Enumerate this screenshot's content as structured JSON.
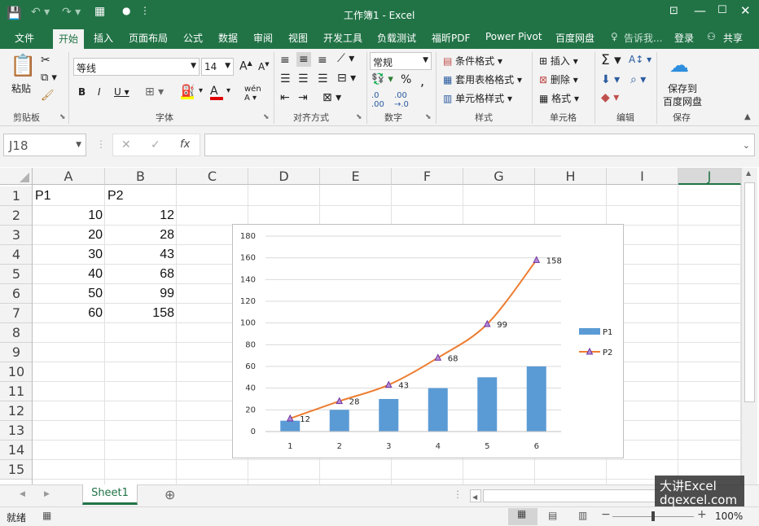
{
  "title_bar": {
    "title": "工作簿1 - Excel"
  },
  "menu": {
    "items": [
      "文件",
      "开始",
      "插入",
      "页面布局",
      "公式",
      "数据",
      "审阅",
      "视图",
      "开发工具",
      "负载测试",
      "福昕PDF",
      "Power Pivot",
      "百度网盘"
    ],
    "tell_me": "告诉我...",
    "login": "登录",
    "share": "共享"
  },
  "ribbon": {
    "paste": "粘贴",
    "clipboard": "剪贴板",
    "font_name": "等线",
    "font_size": "14",
    "font_group": "字体",
    "align_group": "对齐方式",
    "number_format": "常规",
    "number_group": "数字",
    "cond_format": "条件格式",
    "table_format": "套用表格格式",
    "cell_style": "单元格样式",
    "style_group": "样式",
    "insert": "插入",
    "delete": "删除",
    "format": "格式",
    "cells_group": "单元格",
    "edit_group": "编辑",
    "save_to": "保存到",
    "baidu_disk": "百度网盘",
    "save_group": "保存"
  },
  "formula_bar": {
    "name_box": "J18",
    "fx": "fx",
    "formula": ""
  },
  "columns": [
    "A",
    "B",
    "C",
    "D",
    "E",
    "F",
    "G",
    "H",
    "I",
    "J"
  ],
  "rows": [
    "1",
    "2",
    "3",
    "4",
    "5",
    "6",
    "7",
    "8",
    "9",
    "10",
    "11",
    "12",
    "13",
    "14",
    "15"
  ],
  "cells": {
    "A1": "P1",
    "B1": "P2",
    "A2": "10",
    "B2": "12",
    "A3": "20",
    "B3": "28",
    "A4": "30",
    "B4": "43",
    "A5": "40",
    "B5": "68",
    "A6": "50",
    "B6": "99",
    "A7": "60",
    "B7": "158"
  },
  "chart_data": {
    "type": "bar",
    "categories": [
      "1",
      "2",
      "3",
      "4",
      "5",
      "6"
    ],
    "series": [
      {
        "name": "P1",
        "type": "bar",
        "values": [
          10,
          20,
          30,
          40,
          50,
          60
        ],
        "color": "#5b9bd5"
      },
      {
        "name": "P2",
        "type": "line",
        "values": [
          12,
          28,
          43,
          68,
          99,
          158
        ],
        "color": "#ed7d31",
        "marker_color": "#7030a0",
        "data_labels": true
      }
    ],
    "ylim": [
      0,
      180
    ],
    "yticks": [
      "0",
      "20",
      "40",
      "60",
      "80",
      "100",
      "120",
      "140",
      "160",
      "180"
    ],
    "grid": true,
    "legend": "right"
  },
  "sheet_tabs": {
    "active": "Sheet1"
  },
  "status_bar": {
    "ready": "就绪",
    "zoom": "100%"
  },
  "watermark": {
    "line1": "大讲Excel",
    "line2": "dqexcel.com"
  },
  "colors": {
    "excel_green": "#217346",
    "bar_blue": "#5b9bd5",
    "line_orange": "#ed7d31"
  }
}
